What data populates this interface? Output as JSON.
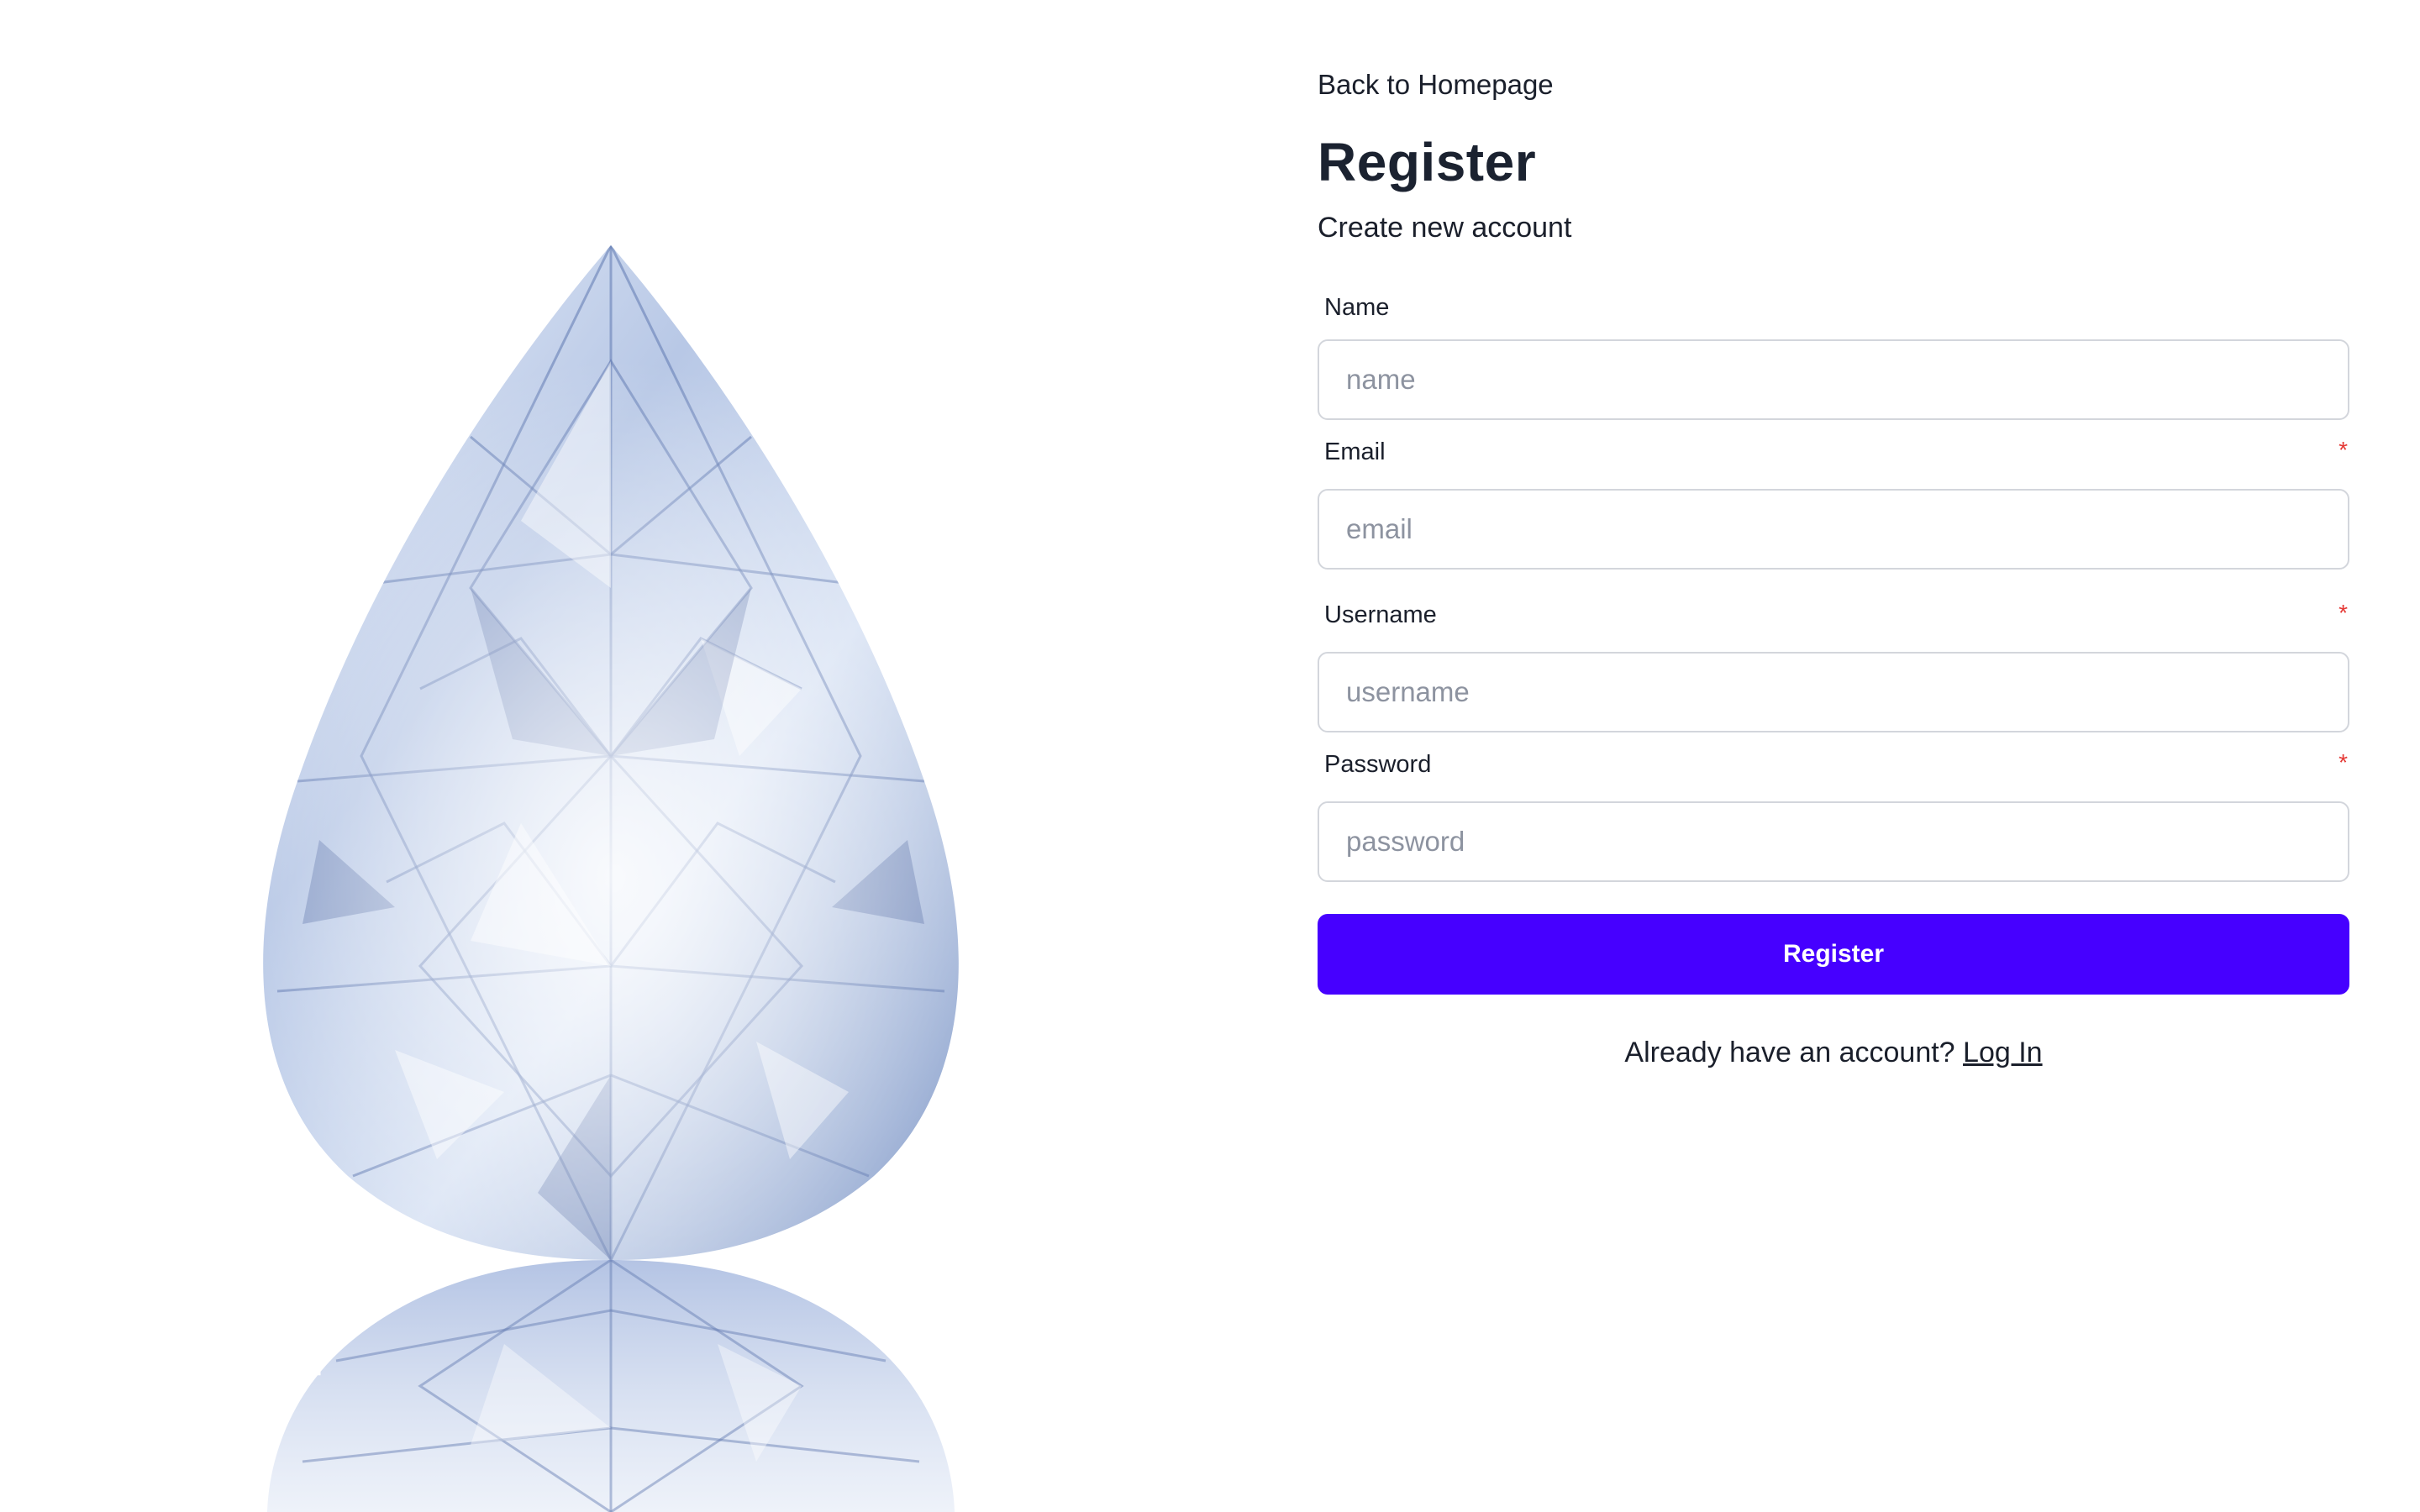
{
  "nav": {
    "back_label": "Back to Homepage"
  },
  "header": {
    "title": "Register",
    "subtitle": "Create new account"
  },
  "form": {
    "fields": [
      {
        "label": "Name",
        "placeholder": "name",
        "required": false
      },
      {
        "label": "Email",
        "placeholder": "email",
        "required": true
      },
      {
        "label": "Username",
        "placeholder": "username",
        "required": true
      },
      {
        "label": "Password",
        "placeholder": "password",
        "required": true
      }
    ],
    "required_mark": "*",
    "submit_label": "Register"
  },
  "footer": {
    "prompt": "Already have an account?",
    "login_label": "Log In"
  },
  "colors": {
    "primary": "#4600ff",
    "required": "#e53935",
    "text": "#1a1f2b",
    "input_border": "#d3d6dc"
  },
  "hero": {
    "icon": "pear-diamond-image"
  }
}
